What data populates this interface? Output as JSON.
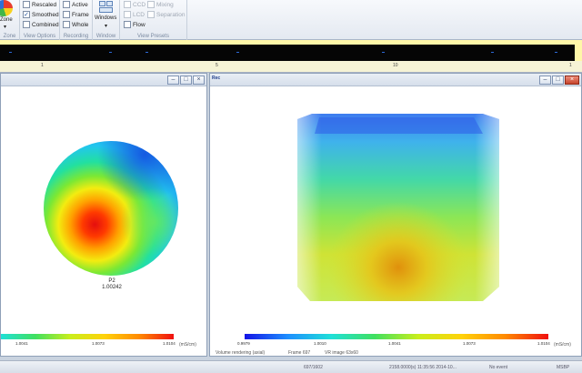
{
  "ribbon": {
    "zone": {
      "label": "Zone",
      "group_label": "Zone"
    },
    "view_options": {
      "group_label": "View Options",
      "rescaled": {
        "label": "Rescaled",
        "checked": false
      },
      "smoothed": {
        "label": "Smoothed",
        "checked": true
      },
      "combined": {
        "label": "Combined",
        "checked": false
      }
    },
    "recording": {
      "group_label": "Recording",
      "active": {
        "label": "Active",
        "checked": false
      },
      "frame": {
        "label": "Frame",
        "checked": false
      },
      "whole": {
        "label": "Whole",
        "checked": false
      }
    },
    "window": {
      "group_label": "Window",
      "windows_label": "Windows"
    },
    "view_presets": {
      "group_label": "View Presets",
      "ccd": {
        "label": "CCD",
        "checked": false
      },
      "lcd": {
        "label": "LCD",
        "checked": false
      },
      "flow": {
        "label": "Flow",
        "checked": false
      },
      "mixing": {
        "label": "Mixing",
        "checked": false
      },
      "separation": {
        "label": "Separation",
        "checked": false
      }
    }
  },
  "timeline": {
    "labels": [
      "1",
      "5",
      "10",
      "1"
    ]
  },
  "left_panel": {
    "plane_label": "P2",
    "plane_value": "1.00242",
    "colorbar_ticks": [
      "1.0041",
      "1.0073",
      "1.0104"
    ],
    "colorbar_unit": "(mS/cm)"
  },
  "right_panel": {
    "title": "Rec",
    "colorbar_ticks": [
      "0.9979",
      "1.0010",
      "1.0041",
      "1.0073",
      "1.0104"
    ],
    "colorbar_unit": "(mS/cm)",
    "footer": {
      "mode": "Volume rendering (axial)",
      "frame": "Frame 697",
      "image": "VR image 63x60"
    }
  },
  "status_bar": {
    "frame_count": "697/1602",
    "timestamp": "2158.0000(s) 11:35:56 2014-10...",
    "event": "No event",
    "mode": "MSBP"
  },
  "colors": {
    "timeline_bg": "#fff7a8",
    "colormap": [
      "#1414e6",
      "#1e8fff",
      "#1fe0d8",
      "#40e060",
      "#c9ee1c",
      "#ffd20a",
      "#ff8a00",
      "#f01010"
    ]
  }
}
